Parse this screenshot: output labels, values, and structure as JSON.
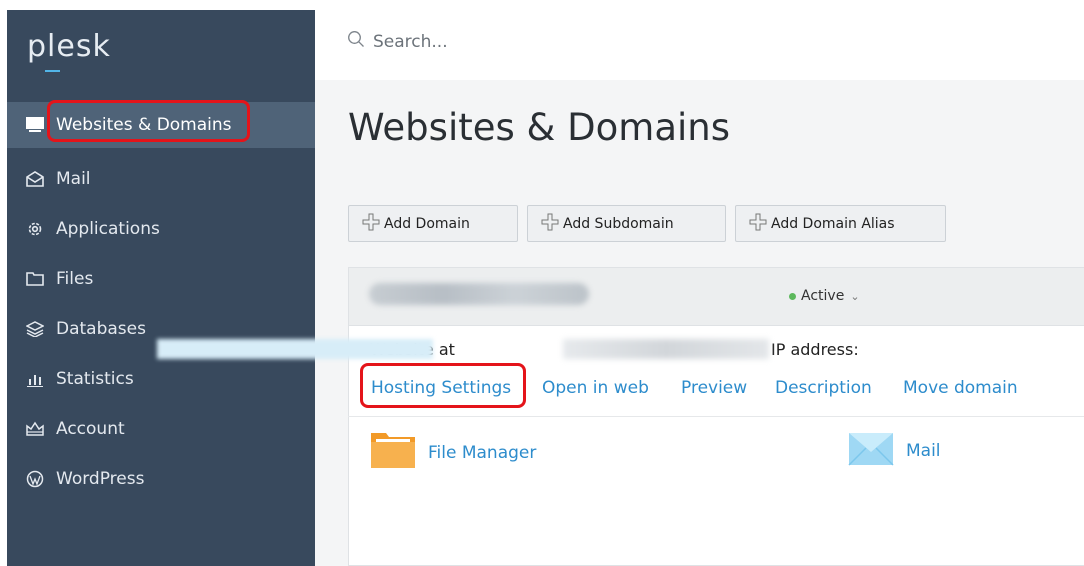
{
  "sidebar": {
    "logo": "plesk",
    "items": [
      {
        "label": "Websites & Domains",
        "icon": "monitor-icon"
      },
      {
        "label": "Mail",
        "icon": "envelope-icon"
      },
      {
        "label": "Applications",
        "icon": "gear-icon"
      },
      {
        "label": "Files",
        "icon": "folder-icon"
      },
      {
        "label": "Databases",
        "icon": "database-icon"
      },
      {
        "label": "Statistics",
        "icon": "bar-chart-icon"
      },
      {
        "label": "Account",
        "icon": "account-icon"
      },
      {
        "label": "WordPress",
        "icon": "wordpress-icon"
      }
    ]
  },
  "search": {
    "placeholder": "Search..."
  },
  "page": {
    "title": "Websites & Domains"
  },
  "toolbar": {
    "add_domain": "Add Domain",
    "add_subdomain": "Add Subdomain",
    "add_domain_alias": "Add Domain Alias"
  },
  "domain": {
    "status": "Active",
    "website_at_label": "Website at",
    "ip_label": "IP address:",
    "links": [
      "Hosting Settings",
      "Open in web",
      "Preview",
      "Description",
      "Move domain"
    ],
    "tools": [
      {
        "label": "File Manager",
        "icon": "folder-icon"
      },
      {
        "label": "Mail",
        "icon": "mail-icon"
      }
    ]
  },
  "colors": {
    "sidebar_bg": "#38495d",
    "sidebar_active": "#4f6378",
    "link": "#2d8ccc",
    "highlight": "#e4141a",
    "status_active": "#5cb85c"
  }
}
